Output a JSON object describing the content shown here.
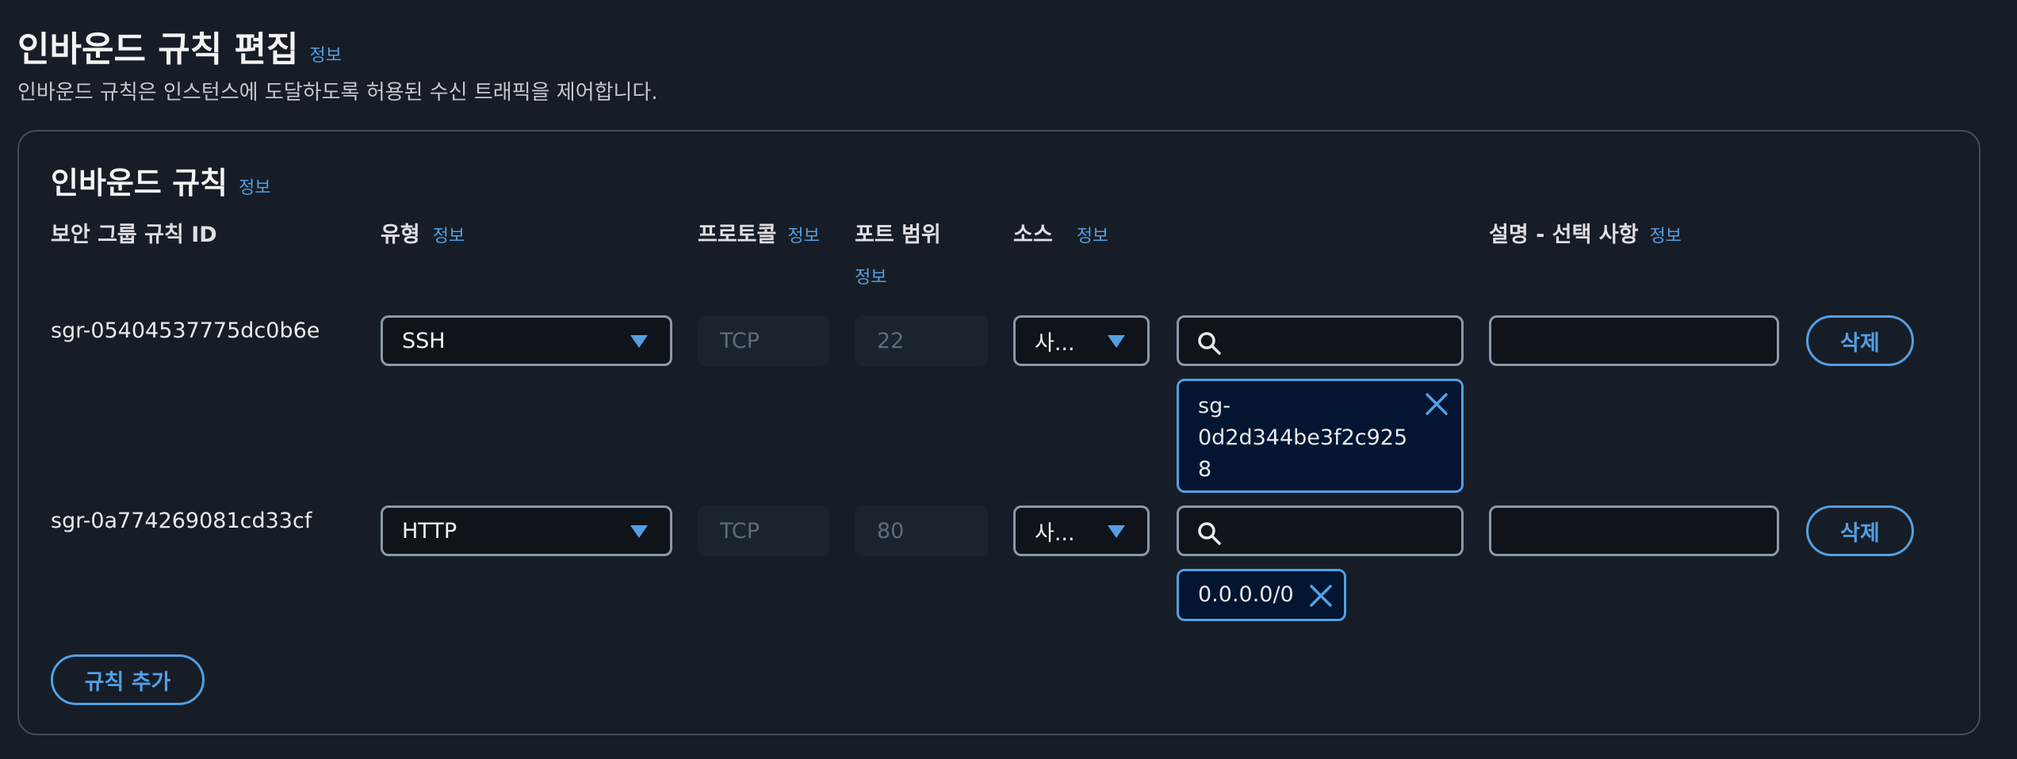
{
  "header": {
    "title": "인바운드 규칙 편집",
    "info": "정보",
    "description": "인바운드 규칙은 인스턴스에 도달하도록 허용된 수신 트래픽을 제어합니다."
  },
  "panel": {
    "title": "인바운드 규칙",
    "info": "정보",
    "columns": {
      "rule_id": "보안 그룹 규칙 ID",
      "type": "유형",
      "type_info": "정보",
      "protocol": "프로토콜",
      "protocol_info": "정보",
      "port_range": "포트 범위",
      "port_range_info": "정보",
      "source": "소스",
      "source_info": "정보",
      "description": "설명 - 선택 사항",
      "description_info": "정보"
    },
    "rules": [
      {
        "id": "sgr-05404537775dc0b6e",
        "type": "SSH",
        "protocol": "TCP",
        "port": "22",
        "source": "사...",
        "token_line1": "sg-",
        "token_line2": "0d2d344be3f2c925",
        "token_line3": "8",
        "delete": "삭제"
      },
      {
        "id": "sgr-0a774269081cd33cf",
        "type": "HTTP",
        "protocol": "TCP",
        "port": "80",
        "source": "사...",
        "token": "0.0.0.0/0",
        "delete": "삭제"
      }
    ],
    "add_rule": "규칙 추가"
  },
  "colors": {
    "background": "#161d26",
    "accent": "#539fe5",
    "border": "#8d99a8"
  }
}
